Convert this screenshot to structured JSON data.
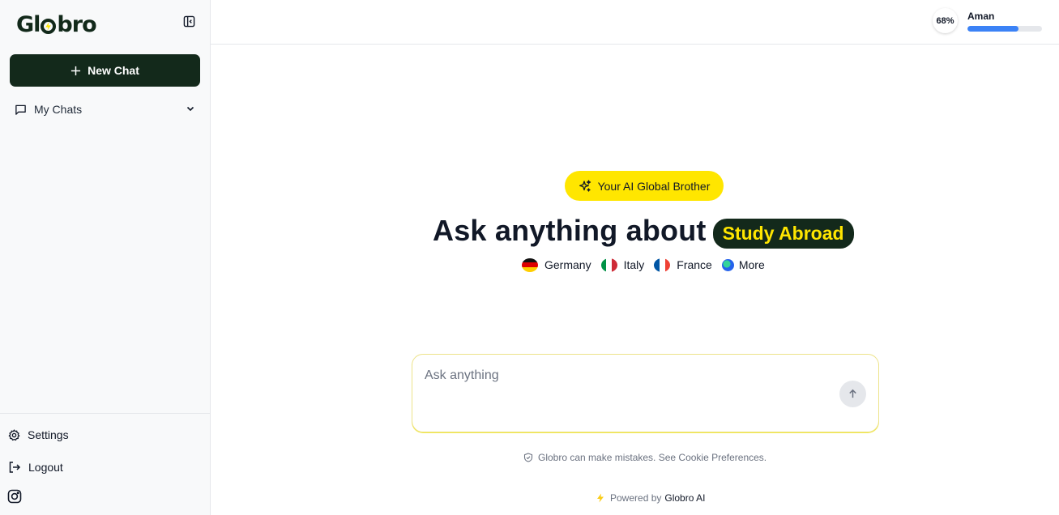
{
  "sidebar": {
    "logo_prefix": "Gl",
    "logo_suffix": "bro",
    "new_chat_label": "New Chat",
    "my_chats_label": "My Chats",
    "settings_label": "Settings",
    "logout_label": "Logout"
  },
  "header": {
    "progress_label": "68%",
    "progress_value": 0.68,
    "user_name": "Aman",
    "accent_color": "#3b82f6"
  },
  "main": {
    "badge_label": "Your AI Global Brother",
    "headline": "Ask anything about",
    "headline_highlight": "Study Abroad",
    "countries": [
      {
        "label": "Germany"
      },
      {
        "label": "Italy"
      },
      {
        "label": "France"
      },
      {
        "label": "More"
      }
    ],
    "prompt_placeholder": "Ask anything",
    "disclaimer": "Globro can make mistakes. See Cookie Preferences.",
    "powered_prefix": "Powered by",
    "powered_brand": "Globro AI"
  },
  "colors": {
    "brand_dark": "#13291b",
    "brand_yellow": "#ffe600"
  }
}
